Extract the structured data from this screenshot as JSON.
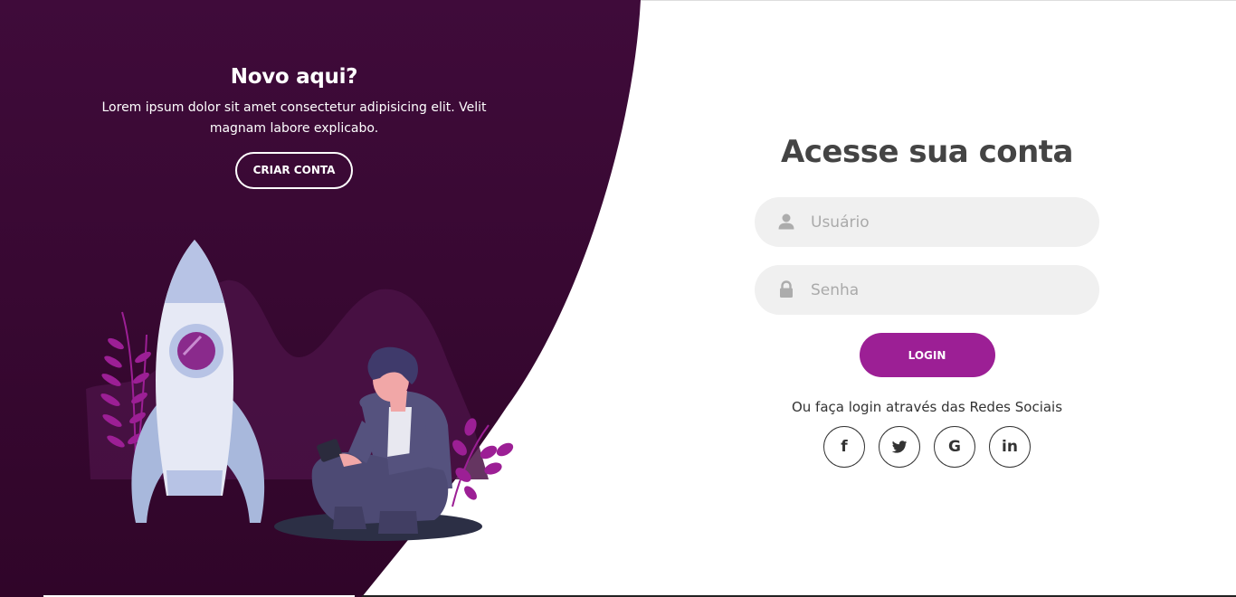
{
  "left_panel": {
    "title": "Novo aqui?",
    "text": "Lorem ipsum dolor sit amet consectetur adipisicing elit. Velit magnam labore explicabo.",
    "button_label": "CRIAR CONTA"
  },
  "login_form": {
    "title": "Acesse sua conta",
    "username_placeholder": "Usuário",
    "password_placeholder": "Senha",
    "submit_label": "LOGIN",
    "social_text": "Ou faça login através das Redes Sociais",
    "socials": [
      {
        "icon": "facebook-icon",
        "glyph": "f"
      },
      {
        "icon": "twitter-icon",
        "glyph": ""
      },
      {
        "icon": "google-icon",
        "glyph": "G"
      },
      {
        "icon": "linkedin-icon",
        "glyph": "in"
      }
    ]
  },
  "colors": {
    "panel_bg": "#3d0a38",
    "accent": "#9c1f95",
    "input_bg": "#f0f0f0",
    "title_text": "#444444"
  },
  "illustrations": [
    "rocket-illustration",
    "person-with-phone-illustration",
    "plant-leaves"
  ]
}
